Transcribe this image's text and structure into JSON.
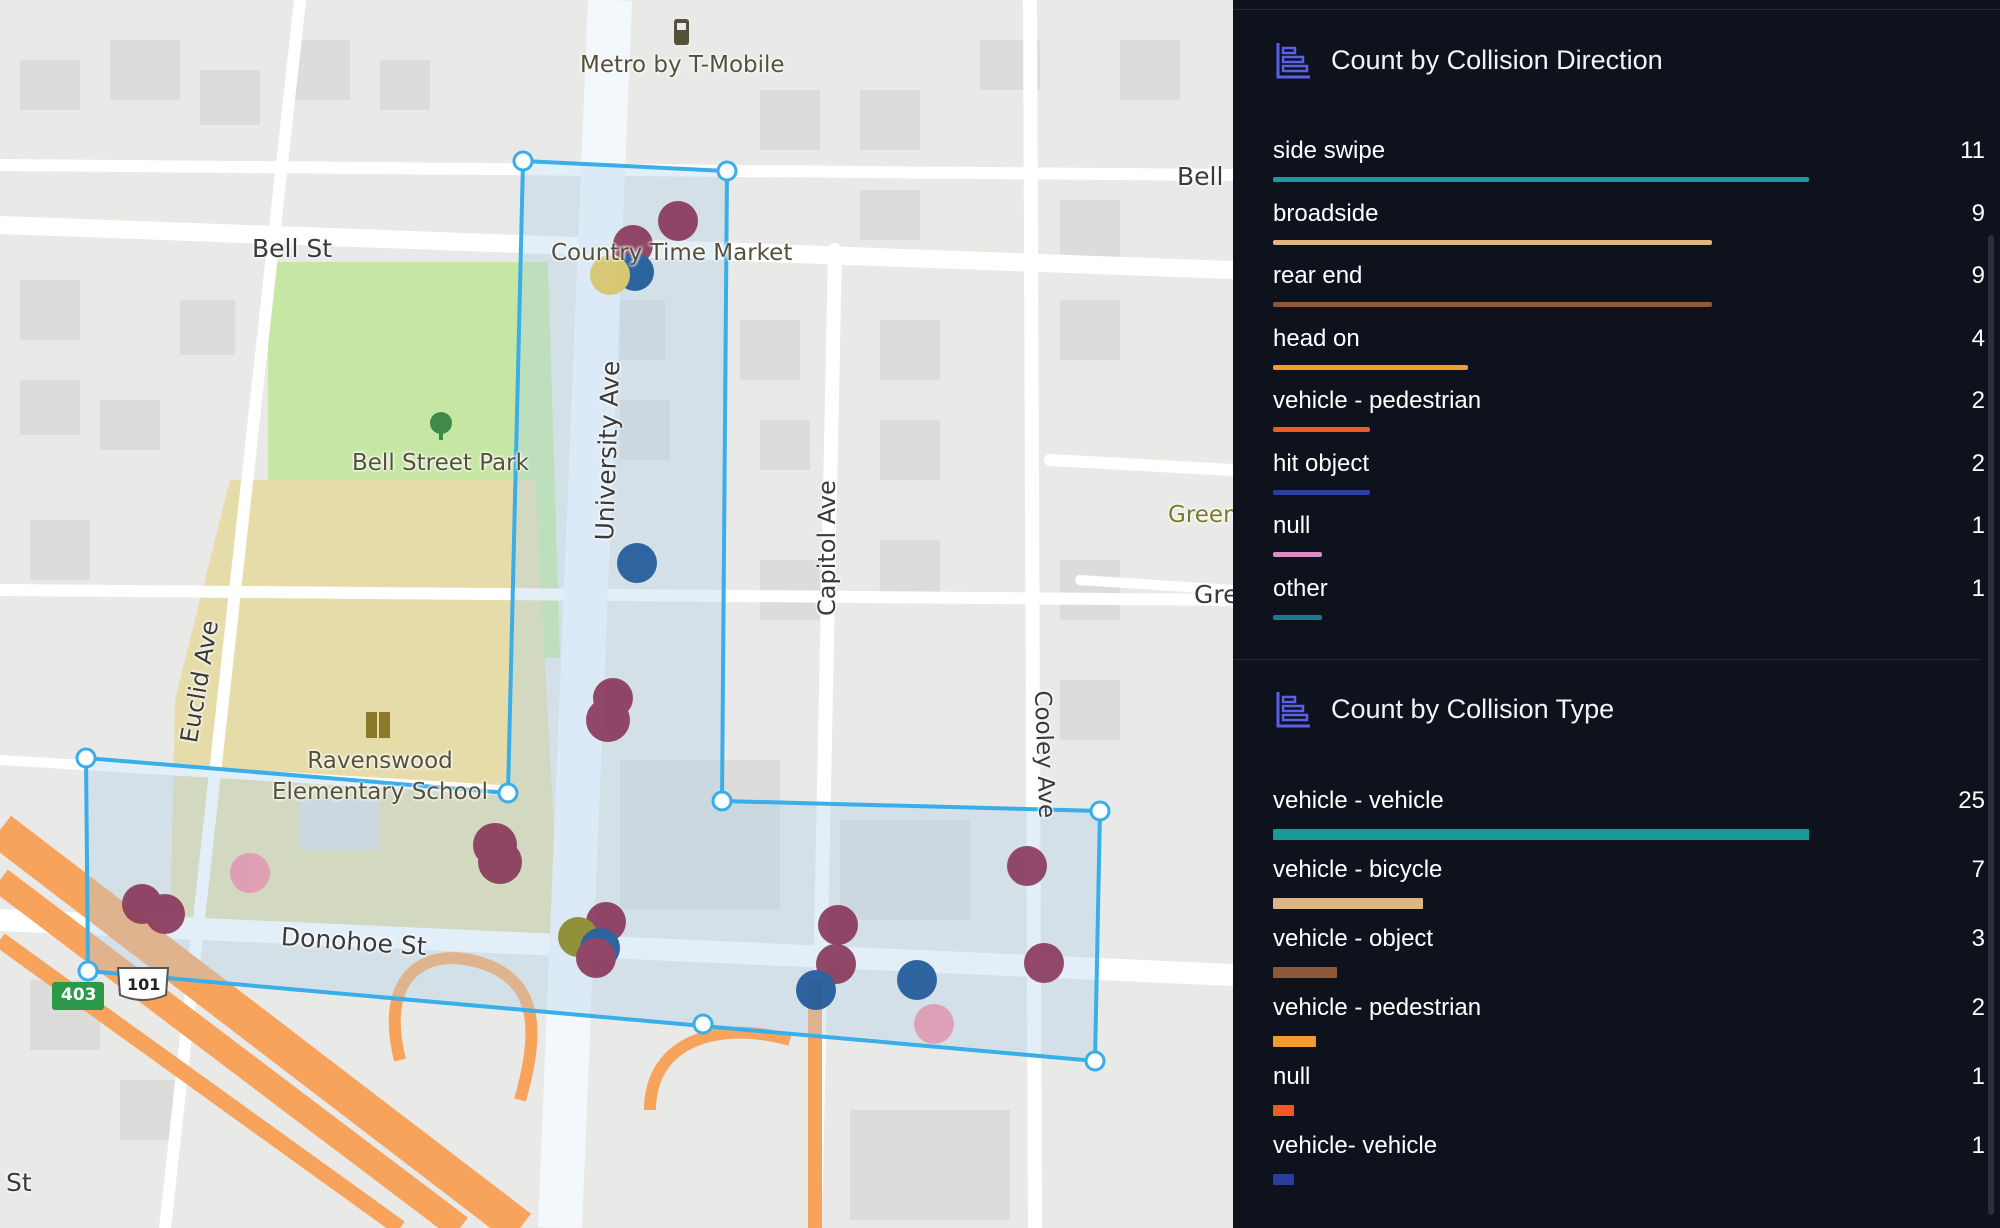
{
  "map": {
    "labels": {
      "metro": "Metro by T-Mobile",
      "bell_st": "Bell St",
      "bell_east": "Bell",
      "country_time": "Country Time Market",
      "bell_street_park": "Bell Street Park",
      "university_ave": "University Ave",
      "capitol_ave": "Capitol Ave",
      "euclid_ave": "Euclid Ave",
      "cooley_ave": "Cooley Ave",
      "ravenswood": "Ravenswood\nElementary School",
      "donohoe_st": "Donohoe St",
      "green": "Green",
      "gre": "Gre",
      "st_left": "St",
      "route_101": "101",
      "route_403": "403"
    },
    "colors": {
      "selection": "#39aee8",
      "incident_maroon": "#8a3a5c",
      "incident_blue": "#1f5a9a",
      "incident_pink": "#df9bb5",
      "incident_yellow": "#d8c56b",
      "incident_olive": "#8a8a2a",
      "highway": "#f7a35c"
    }
  },
  "panel": {
    "direction": {
      "title": "Count by Collision Direction",
      "icon": "bar-chart-icon",
      "items": [
        {
          "label": "side swipe",
          "value": 11,
          "color": "#1a9a9a"
        },
        {
          "label": "broadside",
          "value": 9,
          "color": "#e0b487"
        },
        {
          "label": "rear end",
          "value": 9,
          "color": "#8c5a38"
        },
        {
          "label": "head on",
          "value": 4,
          "color": "#f59a2e"
        },
        {
          "label": "vehicle - pedestrian",
          "value": 2,
          "color": "#f05a24"
        },
        {
          "label": "hit object",
          "value": 2,
          "color": "#2a3f9c"
        },
        {
          "label": "null",
          "value": 1,
          "color": "#d88bc4"
        },
        {
          "label": "other",
          "value": 1,
          "color": "#1b7a8c"
        }
      ]
    },
    "type": {
      "title": "Count by Collision Type",
      "icon": "bar-chart-icon",
      "items": [
        {
          "label": "vehicle - vehicle",
          "value": 25,
          "color": "#1a9a9a"
        },
        {
          "label": "vehicle - bicycle",
          "value": 7,
          "color": "#e0b487"
        },
        {
          "label": "vehicle - object",
          "value": 3,
          "color": "#8c5a38"
        },
        {
          "label": "vehicle - pedestrian",
          "value": 2,
          "color": "#f59a2e"
        },
        {
          "label": "null",
          "value": 1,
          "color": "#f05a24"
        },
        {
          "label": "vehicle- vehicle",
          "value": 1,
          "color": "#2a3f9c"
        }
      ]
    }
  }
}
